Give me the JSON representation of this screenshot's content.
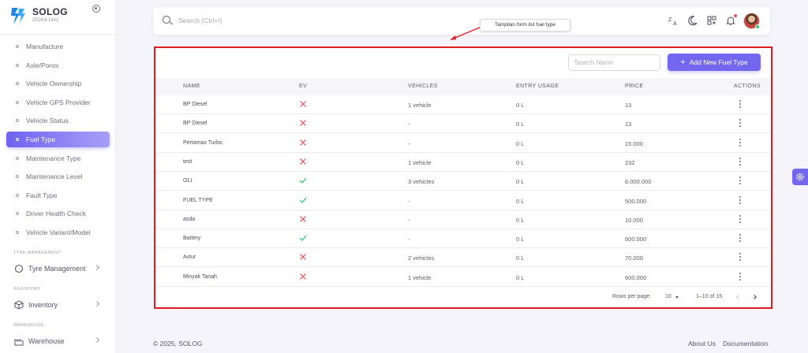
{
  "app": {
    "title": "SOLOG",
    "version": "2024.6.14#1"
  },
  "search": {
    "placeholder": "Search (Ctrl+/)"
  },
  "annotation": {
    "text": "Tampilan form list fuel type"
  },
  "sidebar": {
    "items": [
      {
        "label": "Manufacture"
      },
      {
        "label": "Axle/Poros"
      },
      {
        "label": "Vehicle Ownership"
      },
      {
        "label": "Vehicle GPS Provider"
      },
      {
        "label": "Vehicle Status"
      },
      {
        "label": "Fuel Type",
        "active": true
      },
      {
        "label": "Maintenance Type"
      },
      {
        "label": "Maintenance Level"
      },
      {
        "label": "Fault Type"
      },
      {
        "label": "Driver Health Check"
      },
      {
        "label": "Vehicle Variant/Model"
      }
    ],
    "sections": [
      {
        "label": "TYRE MANAGEMENT",
        "group": "Tyre Management",
        "icon": "circle-icon"
      },
      {
        "label": "INVENTORY",
        "group": "Inventory",
        "icon": "box-icon"
      },
      {
        "label": "WAREHOUSE",
        "group": "Warehouse",
        "icon": "warehouse-icon"
      }
    ]
  },
  "toolbar": {
    "search_placeholder": "Search Name",
    "add_label": "Add New Fuel Type"
  },
  "table": {
    "columns": [
      "NAME",
      "EV",
      "VEHICLES",
      "ENTRY USAGE",
      "PRICE",
      "ACTIONS"
    ],
    "rows": [
      {
        "name": "BP Diesel",
        "ev": false,
        "vehicles": "1 vehicle",
        "entry_usage": "0 L",
        "price": "13"
      },
      {
        "name": "BP Diesel",
        "ev": false,
        "vehicles": "-",
        "entry_usage": "0 L",
        "price": "13"
      },
      {
        "name": "Pertamax Turbo",
        "ev": false,
        "vehicles": "-",
        "entry_usage": "0 L",
        "price": "15.000"
      },
      {
        "name": "test",
        "ev": false,
        "vehicles": "1 vehicle",
        "entry_usage": "0 L",
        "price": "232"
      },
      {
        "name": "OLI",
        "ev": true,
        "vehicles": "3 vehicles",
        "entry_usage": "0 L",
        "price": "6.000.000"
      },
      {
        "name": "FUEL TYPE",
        "ev": true,
        "vehicles": "-",
        "entry_usage": "0 L",
        "price": "500.000"
      },
      {
        "name": "asda",
        "ev": false,
        "vehicles": "-",
        "entry_usage": "0 L",
        "price": "10.000"
      },
      {
        "name": "Battery",
        "ev": true,
        "vehicles": "-",
        "entry_usage": "0 L",
        "price": "600.000"
      },
      {
        "name": "Avtur",
        "ev": false,
        "vehicles": "2 vehicles",
        "entry_usage": "0 L",
        "price": "70.000"
      },
      {
        "name": "Minyak Tanah",
        "ev": false,
        "vehicles": "1 vehicle",
        "entry_usage": "0 L",
        "price": "600.000"
      }
    ]
  },
  "pagination": {
    "rows_label": "Rows per page:",
    "rows_value": "10",
    "range": "1–10 of 15"
  },
  "footer": {
    "copyright": "© 2025, SOLOG",
    "about": "About Us",
    "docs": "Documentation"
  },
  "colors": {
    "accent": "#7367f0",
    "danger": "#ea5455",
    "success": "#28c76f",
    "highlight_border": "#e01b24"
  }
}
